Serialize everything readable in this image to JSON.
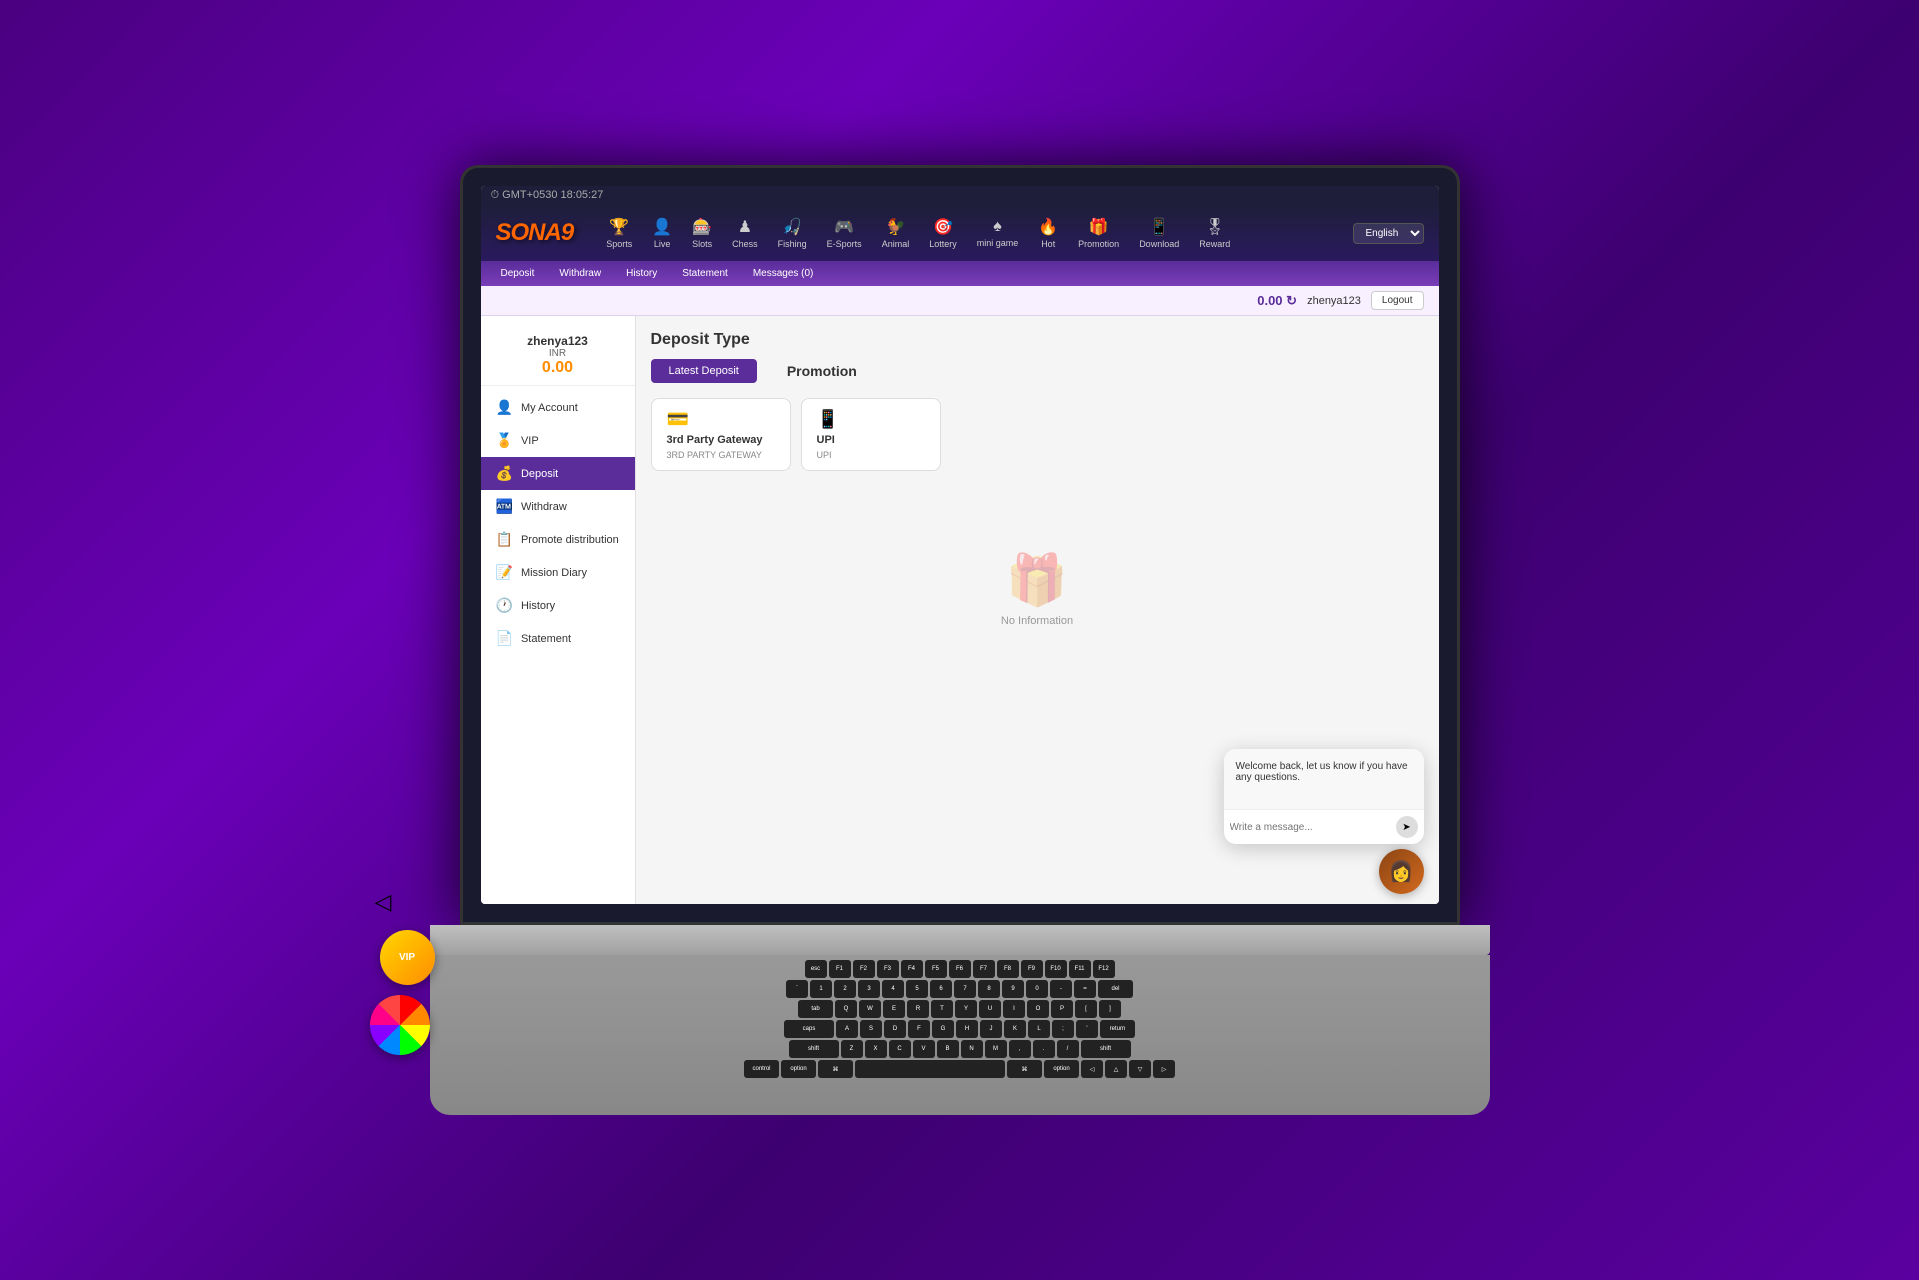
{
  "topbar": {
    "timezone": "⏱ GMT+0530 18:05:27"
  },
  "header": {
    "logo": "SONA9",
    "nav_items": [
      {
        "id": "sports",
        "icon": "🏆",
        "label": "Sports"
      },
      {
        "id": "live",
        "icon": "👤",
        "label": "Live"
      },
      {
        "id": "slots",
        "icon": "🎰",
        "label": "Slots"
      },
      {
        "id": "chess",
        "icon": "♟",
        "label": "Chess"
      },
      {
        "id": "fishing",
        "icon": "🎣",
        "label": "Fishing"
      },
      {
        "id": "esports",
        "icon": "🎮",
        "label": "E-Sports"
      },
      {
        "id": "animal",
        "icon": "🐓",
        "label": "Animal"
      },
      {
        "id": "lottery",
        "icon": "🎯",
        "label": "Lottery"
      },
      {
        "id": "minigame",
        "icon": "♠",
        "label": "mini game"
      },
      {
        "id": "hot",
        "icon": "🔥",
        "label": "Hot"
      },
      {
        "id": "promotion",
        "icon": "🎁",
        "label": "Promotion"
      },
      {
        "id": "download",
        "icon": "📱",
        "label": "Download"
      },
      {
        "id": "reward",
        "icon": "🎖",
        "label": "Reward"
      }
    ],
    "language": "English"
  },
  "subnav": {
    "items": [
      "Deposit",
      "Withdraw",
      "History",
      "Statement",
      "Messages (0)"
    ]
  },
  "balancebar": {
    "amount": "0.00",
    "currency_icon": "↻",
    "username": "zhenya123",
    "logout_label": "Logout"
  },
  "sidebar": {
    "username": "zhenya123",
    "currency": "INR",
    "balance": "0.00",
    "items": [
      {
        "id": "my-account",
        "icon": "👤",
        "label": "My Account",
        "active": false
      },
      {
        "id": "vip",
        "icon": "🏅",
        "label": "VIP",
        "active": false
      },
      {
        "id": "deposit",
        "icon": "💰",
        "label": "Deposit",
        "active": true
      },
      {
        "id": "withdraw",
        "icon": "🏧",
        "label": "Withdraw",
        "active": false
      },
      {
        "id": "promote",
        "icon": "📋",
        "label": "Promote distribution",
        "active": false
      },
      {
        "id": "mission",
        "icon": "📝",
        "label": "Mission Diary",
        "active": false
      },
      {
        "id": "history",
        "icon": "🕐",
        "label": "History",
        "active": false
      },
      {
        "id": "statement",
        "icon": "📄",
        "label": "Statement",
        "active": false
      }
    ]
  },
  "content": {
    "title": "Deposit Type",
    "tabs": [
      {
        "label": "Latest Deposit",
        "active": true
      },
      {
        "label": "Promotion",
        "active": false
      }
    ],
    "payment_methods": [
      {
        "icon": "💳",
        "name": "3rd Party Gateway",
        "sub": "3RD PARTY GATEWAY"
      },
      {
        "icon": "📱",
        "name": "UPI",
        "sub": "UPI"
      }
    ],
    "no_info_label": "No Information"
  },
  "chat": {
    "welcome_message": "Welcome back, let us know if you have any questions.",
    "input_placeholder": "Write a message...",
    "send_icon": "➤"
  }
}
